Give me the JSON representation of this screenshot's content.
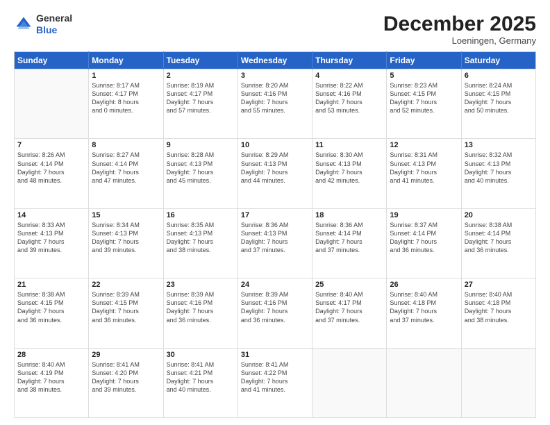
{
  "header": {
    "logo_general": "General",
    "logo_blue": "Blue",
    "month_title": "December 2025",
    "location": "Loeningen, Germany"
  },
  "weekdays": [
    "Sunday",
    "Monday",
    "Tuesday",
    "Wednesday",
    "Thursday",
    "Friday",
    "Saturday"
  ],
  "weeks": [
    [
      {
        "day": "",
        "info": ""
      },
      {
        "day": "1",
        "info": "Sunrise: 8:17 AM\nSunset: 4:17 PM\nDaylight: 8 hours\nand 0 minutes."
      },
      {
        "day": "2",
        "info": "Sunrise: 8:19 AM\nSunset: 4:17 PM\nDaylight: 7 hours\nand 57 minutes."
      },
      {
        "day": "3",
        "info": "Sunrise: 8:20 AM\nSunset: 4:16 PM\nDaylight: 7 hours\nand 55 minutes."
      },
      {
        "day": "4",
        "info": "Sunrise: 8:22 AM\nSunset: 4:16 PM\nDaylight: 7 hours\nand 53 minutes."
      },
      {
        "day": "5",
        "info": "Sunrise: 8:23 AM\nSunset: 4:15 PM\nDaylight: 7 hours\nand 52 minutes."
      },
      {
        "day": "6",
        "info": "Sunrise: 8:24 AM\nSunset: 4:15 PM\nDaylight: 7 hours\nand 50 minutes."
      }
    ],
    [
      {
        "day": "7",
        "info": "Sunrise: 8:26 AM\nSunset: 4:14 PM\nDaylight: 7 hours\nand 48 minutes."
      },
      {
        "day": "8",
        "info": "Sunrise: 8:27 AM\nSunset: 4:14 PM\nDaylight: 7 hours\nand 47 minutes."
      },
      {
        "day": "9",
        "info": "Sunrise: 8:28 AM\nSunset: 4:13 PM\nDaylight: 7 hours\nand 45 minutes."
      },
      {
        "day": "10",
        "info": "Sunrise: 8:29 AM\nSunset: 4:13 PM\nDaylight: 7 hours\nand 44 minutes."
      },
      {
        "day": "11",
        "info": "Sunrise: 8:30 AM\nSunset: 4:13 PM\nDaylight: 7 hours\nand 42 minutes."
      },
      {
        "day": "12",
        "info": "Sunrise: 8:31 AM\nSunset: 4:13 PM\nDaylight: 7 hours\nand 41 minutes."
      },
      {
        "day": "13",
        "info": "Sunrise: 8:32 AM\nSunset: 4:13 PM\nDaylight: 7 hours\nand 40 minutes."
      }
    ],
    [
      {
        "day": "14",
        "info": "Sunrise: 8:33 AM\nSunset: 4:13 PM\nDaylight: 7 hours\nand 39 minutes."
      },
      {
        "day": "15",
        "info": "Sunrise: 8:34 AM\nSunset: 4:13 PM\nDaylight: 7 hours\nand 39 minutes."
      },
      {
        "day": "16",
        "info": "Sunrise: 8:35 AM\nSunset: 4:13 PM\nDaylight: 7 hours\nand 38 minutes."
      },
      {
        "day": "17",
        "info": "Sunrise: 8:36 AM\nSunset: 4:13 PM\nDaylight: 7 hours\nand 37 minutes."
      },
      {
        "day": "18",
        "info": "Sunrise: 8:36 AM\nSunset: 4:14 PM\nDaylight: 7 hours\nand 37 minutes."
      },
      {
        "day": "19",
        "info": "Sunrise: 8:37 AM\nSunset: 4:14 PM\nDaylight: 7 hours\nand 36 minutes."
      },
      {
        "day": "20",
        "info": "Sunrise: 8:38 AM\nSunset: 4:14 PM\nDaylight: 7 hours\nand 36 minutes."
      }
    ],
    [
      {
        "day": "21",
        "info": "Sunrise: 8:38 AM\nSunset: 4:15 PM\nDaylight: 7 hours\nand 36 minutes."
      },
      {
        "day": "22",
        "info": "Sunrise: 8:39 AM\nSunset: 4:15 PM\nDaylight: 7 hours\nand 36 minutes."
      },
      {
        "day": "23",
        "info": "Sunrise: 8:39 AM\nSunset: 4:16 PM\nDaylight: 7 hours\nand 36 minutes."
      },
      {
        "day": "24",
        "info": "Sunrise: 8:39 AM\nSunset: 4:16 PM\nDaylight: 7 hours\nand 36 minutes."
      },
      {
        "day": "25",
        "info": "Sunrise: 8:40 AM\nSunset: 4:17 PM\nDaylight: 7 hours\nand 37 minutes."
      },
      {
        "day": "26",
        "info": "Sunrise: 8:40 AM\nSunset: 4:18 PM\nDaylight: 7 hours\nand 37 minutes."
      },
      {
        "day": "27",
        "info": "Sunrise: 8:40 AM\nSunset: 4:18 PM\nDaylight: 7 hours\nand 38 minutes."
      }
    ],
    [
      {
        "day": "28",
        "info": "Sunrise: 8:40 AM\nSunset: 4:19 PM\nDaylight: 7 hours\nand 38 minutes."
      },
      {
        "day": "29",
        "info": "Sunrise: 8:41 AM\nSunset: 4:20 PM\nDaylight: 7 hours\nand 39 minutes."
      },
      {
        "day": "30",
        "info": "Sunrise: 8:41 AM\nSunset: 4:21 PM\nDaylight: 7 hours\nand 40 minutes."
      },
      {
        "day": "31",
        "info": "Sunrise: 8:41 AM\nSunset: 4:22 PM\nDaylight: 7 hours\nand 41 minutes."
      },
      {
        "day": "",
        "info": ""
      },
      {
        "day": "",
        "info": ""
      },
      {
        "day": "",
        "info": ""
      }
    ]
  ]
}
